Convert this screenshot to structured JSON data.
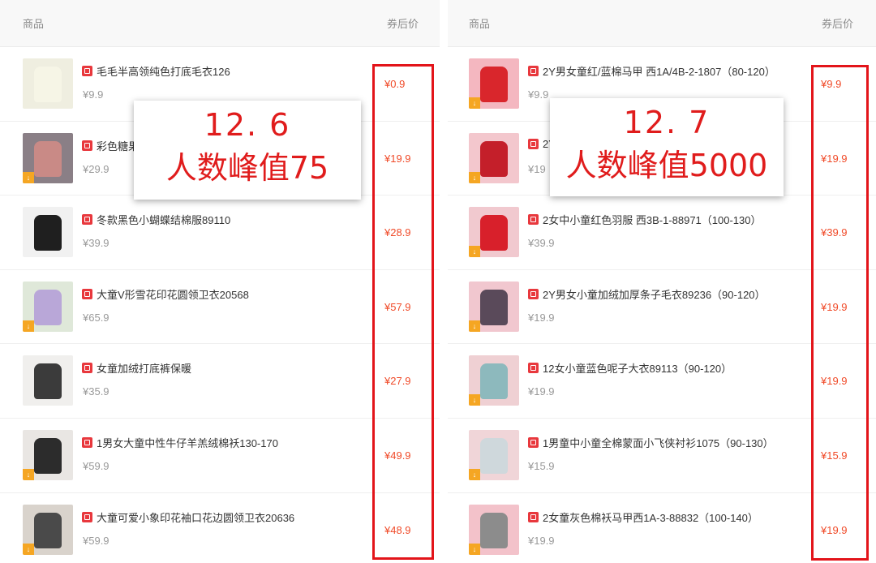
{
  "left_panel": {
    "header": {
      "col_product": "商品",
      "col_price": "券后价"
    },
    "rows": [
      {
        "title": "毛毛半高领纯色打底毛衣126",
        "orig": "¥9.9",
        "coupon": "¥0.9",
        "img_color": "#efeee0",
        "garment_color": "#f6f5e6",
        "badge": false
      },
      {
        "title": "彩色糖果",
        "orig": "¥29.9",
        "coupon": "¥19.9",
        "img_color": "#8a7f86",
        "garment_color": "#c98a86",
        "badge": true
      },
      {
        "title": "冬款黑色小蝴蝶结棉服89110",
        "orig": "¥39.9",
        "coupon": "¥28.9",
        "img_color": "#f1f1f1",
        "garment_color": "#1f1f1f",
        "badge": false
      },
      {
        "title": "大童V形雪花印花圆领卫衣20568",
        "orig": "¥65.9",
        "coupon": "¥57.9",
        "img_color": "#dfe8d9",
        "garment_color": "#b9a7d8",
        "badge": true
      },
      {
        "title": "女童加绒打底裤保暖",
        "orig": "¥35.9",
        "coupon": "¥27.9",
        "img_color": "#f0efed",
        "garment_color": "#3b3b3b",
        "badge": false
      },
      {
        "title": "1男女大童中性牛仔羊羔绒棉袄130-170",
        "orig": "¥59.9",
        "coupon": "¥49.9",
        "img_color": "#e9e6e3",
        "garment_color": "#2c2c2c",
        "badge": true
      },
      {
        "title": "大童可爱小象印花袖口花边圆领卫衣20636",
        "orig": "¥59.9",
        "coupon": "¥48.9",
        "img_color": "#d9d3cc",
        "garment_color": "#4a4a4a",
        "badge": true
      }
    ],
    "note": {
      "date": "12. 6",
      "peak": "人数峰值75"
    }
  },
  "right_panel": {
    "header": {
      "col_product": "商品",
      "col_price": "券后价"
    },
    "rows": [
      {
        "title": "2Y男女童红/蓝棉马甲 西1A/4B-2-1807（80-120）",
        "orig": "¥9.9",
        "coupon": "¥9.9",
        "img_color": "#f4b7c0",
        "garment_color": "#d9262c",
        "badge": true
      },
      {
        "title": "2Y",
        "orig": "¥19",
        "coupon": "¥19.9",
        "img_color": "#f3c7cd",
        "garment_color": "#c41f2a",
        "badge": true
      },
      {
        "title": "2女中小童红色羽服 西3B-1-88971（100-130）",
        "orig": "¥39.9",
        "coupon": "¥39.9",
        "img_color": "#f1c9cf",
        "garment_color": "#d8202b",
        "badge": true
      },
      {
        "title": "2Y男女小童加绒加厚条子毛衣89236（90-120）",
        "orig": "¥19.9",
        "coupon": "¥19.9",
        "img_color": "#f1c7cf",
        "garment_color": "#5a4a5a",
        "badge": true
      },
      {
        "title": "12女小童蓝色呢子大衣89113（90-120）",
        "orig": "¥19.9",
        "coupon": "¥19.9",
        "img_color": "#efd0d3",
        "garment_color": "#8db9bd",
        "badge": true
      },
      {
        "title": "1男童中小童全棉蒙面小飞侠衬衫1075（90-130）",
        "orig": "¥15.9",
        "coupon": "¥15.9",
        "img_color": "#f0d5d8",
        "garment_color": "#cfd8dc",
        "badge": true
      },
      {
        "title": "2女童灰色棉袄马甲西1A-3-88832（100-140）",
        "orig": "¥19.9",
        "coupon": "¥19.9",
        "img_color": "#f3c2ca",
        "garment_color": "#8c8c8c",
        "badge": true
      }
    ],
    "note": {
      "date": "12. 7",
      "peak": "人数峰值5000"
    }
  },
  "colors": {
    "coupon_price": "#f04a28",
    "highlight_box": "#e3141a",
    "note_text": "#e01c1c",
    "taobao_icon": "#e8383d"
  },
  "icons": {
    "product_badge": "taobao-tag-icon",
    "video_badge": "download-badge-icon"
  }
}
